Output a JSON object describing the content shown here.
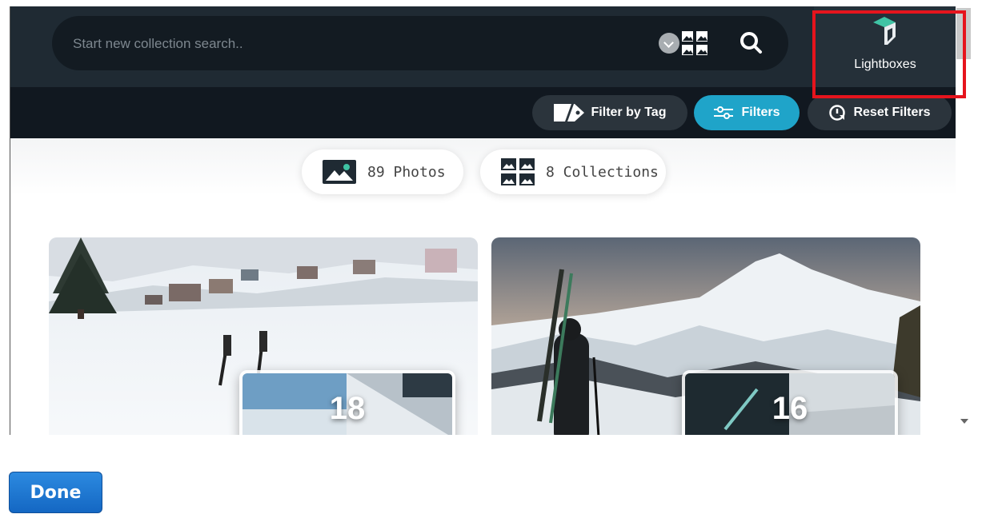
{
  "search": {
    "placeholder": "Start new collection search.."
  },
  "header": {
    "lightboxes_label": "Lightboxes"
  },
  "filters": {
    "filter_by_tag": "Filter by Tag",
    "filters": "Filters",
    "reset_filters": "Reset Filters"
  },
  "counts": {
    "photos": "89 Photos",
    "collections": "8 Collections"
  },
  "cards": [
    {
      "count": "18"
    },
    {
      "count": "16"
    }
  ],
  "footer": {
    "done_label": "Done"
  },
  "colors": {
    "topbar": "#1f2a33",
    "filterbar": "#111820",
    "accent": "#1fa4c9",
    "highlight": "#e6141d",
    "done_button": "#1467c3"
  },
  "icons": [
    "scope-chevron-icon",
    "collections-grid-icon",
    "search-icon",
    "lightbox-box-icon",
    "tag-icon",
    "sliders-icon",
    "reset-icon",
    "photo-icon"
  ]
}
